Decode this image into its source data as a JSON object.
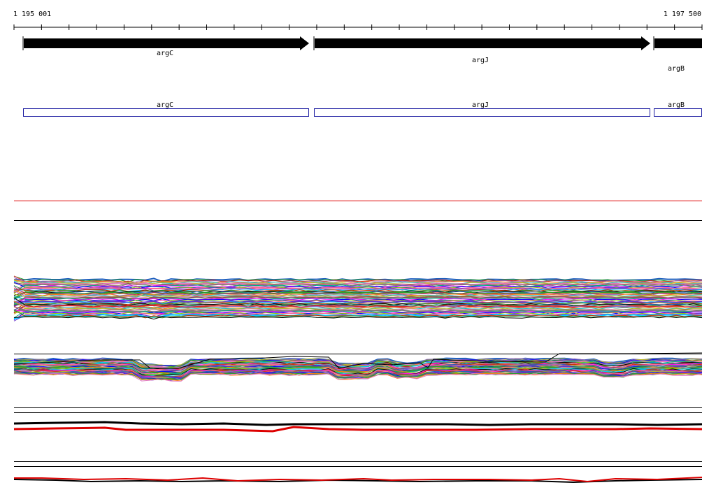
{
  "ruler": {
    "start_label": "1 195 001",
    "end_label": "1 197 500"
  },
  "genes": [
    {
      "name": "argC",
      "strand": "+"
    },
    {
      "name": "argJ",
      "strand": "+"
    },
    {
      "name": "argB",
      "strand": "+"
    }
  ],
  "cds": [
    {
      "name": "argC"
    },
    {
      "name": "argJ"
    },
    {
      "name": "argB"
    }
  ],
  "colors": {
    "gene_fill": "#000000",
    "cds_stroke": "#1a1aa0",
    "track_red": "#dd0000",
    "track_black": "#000000",
    "ruler": "#000000"
  },
  "palette": [
    "#1f5fbf",
    "#2ca02c",
    "#d62728",
    "#9467bd",
    "#ff7f0e",
    "#17becf",
    "#bcbd22",
    "#e377c2",
    "#8c564b",
    "#7f7f7f",
    "#00aa88",
    "#ff00ff",
    "#0000ff",
    "#88cc00",
    "#ff6699",
    "#6633cc",
    "#00ccff",
    "#cc3300",
    "#339933",
    "#000000"
  ]
}
